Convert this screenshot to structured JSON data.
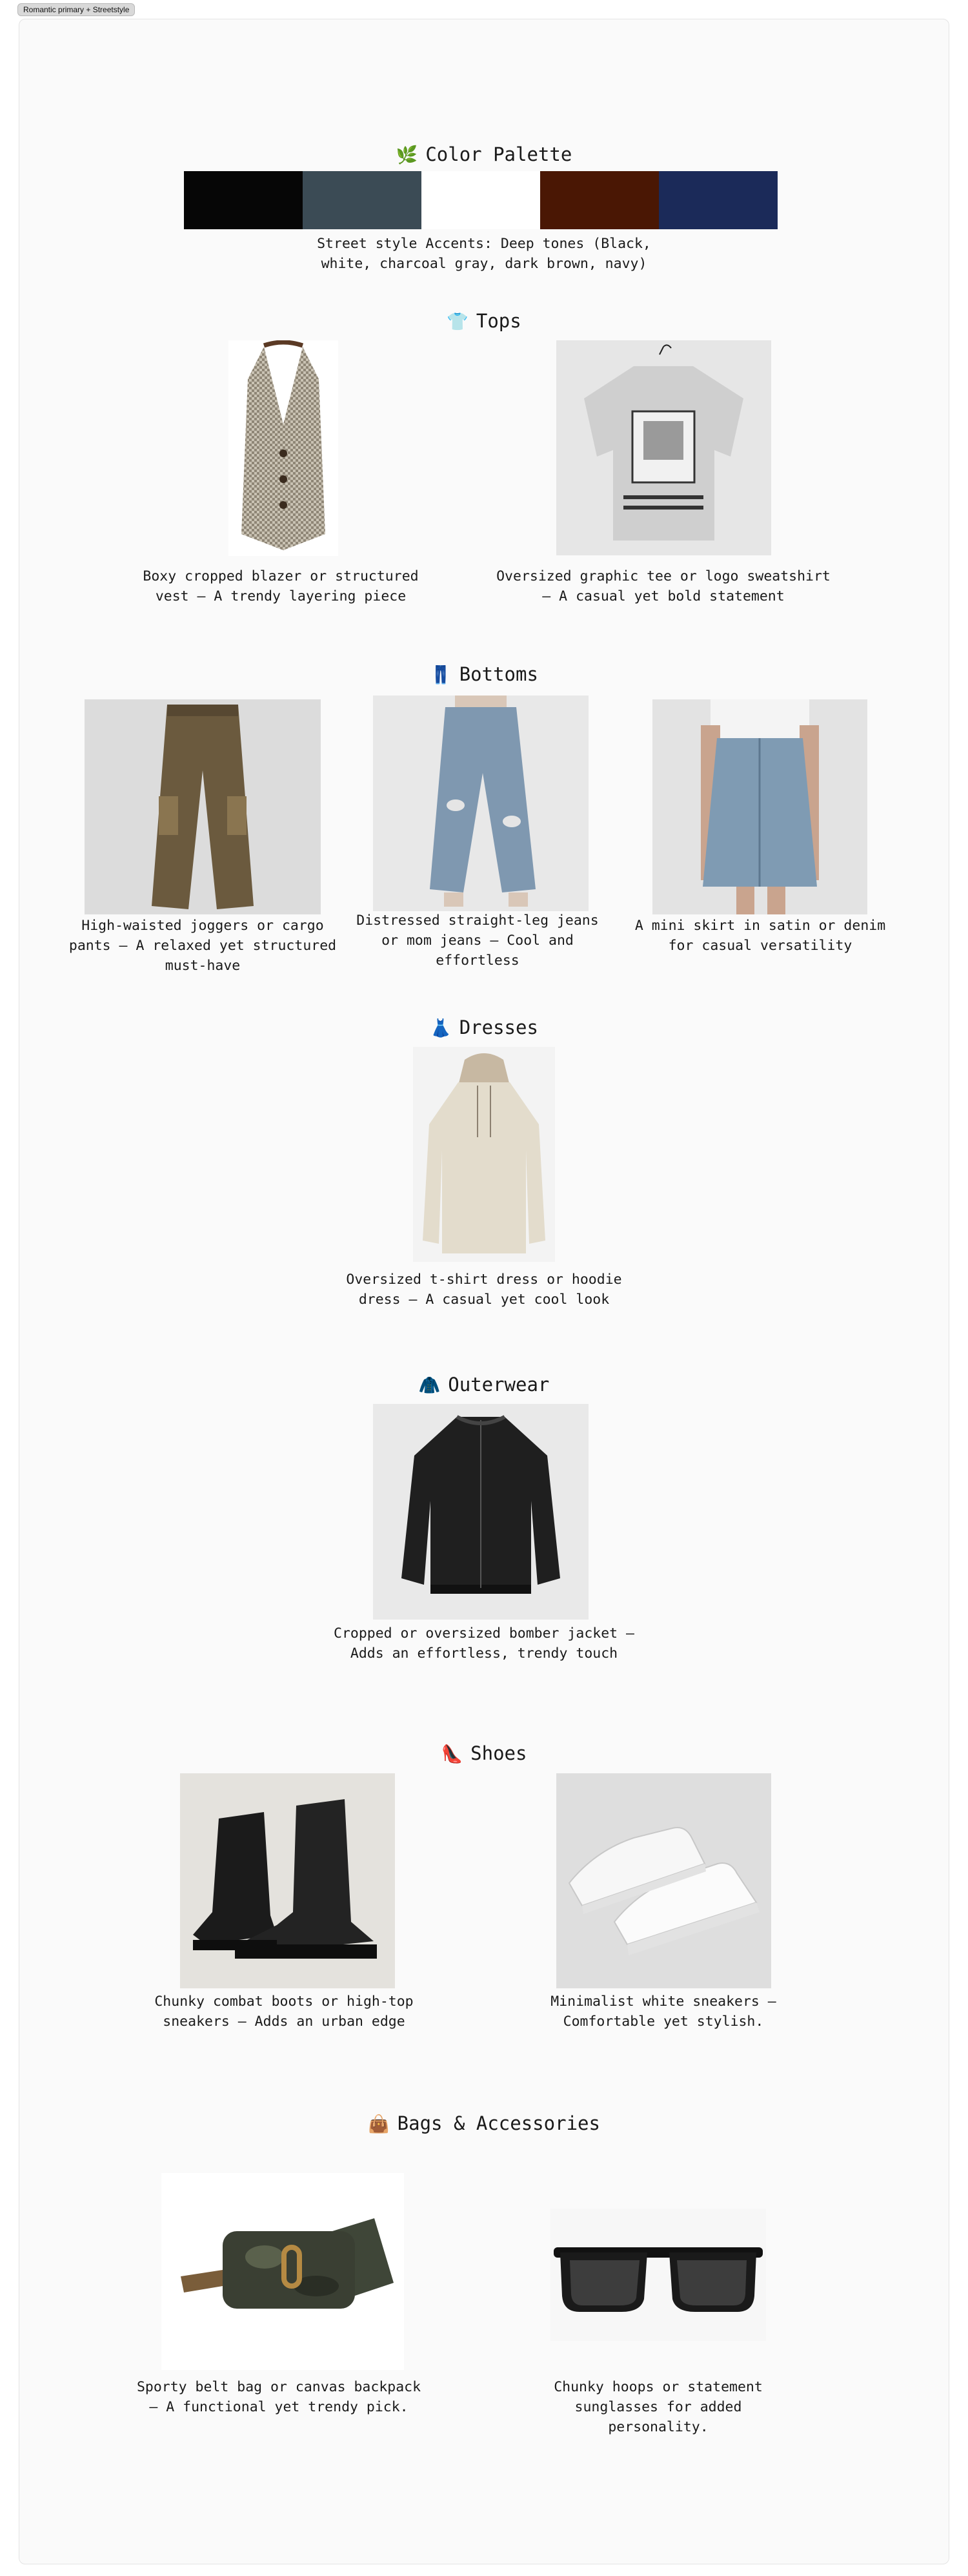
{
  "tab_label": "Romantic primary + Streetstyle",
  "palette": {
    "heading": "Color Palette",
    "heading_icon": "🌿",
    "swatches": [
      "#060606",
      "#3b4b55",
      "#ffffff",
      "#4a1704",
      "#1b2a59"
    ],
    "caption_line1": "Street style Accents: Deep tones (Black,",
    "caption_line2": "white, charcoal gray, dark brown, navy)"
  },
  "tops": {
    "heading": "Tops",
    "heading_icon": "👕",
    "items": [
      {
        "line1": "Boxy cropped blazer or structured",
        "line2": "vest – A trendy layering piece",
        "image": "houndstooth-vest"
      },
      {
        "line1": "Oversized graphic tee or logo sweatshirt",
        "line2": "– A casual yet bold statement",
        "image": "graphic-tee"
      }
    ]
  },
  "bottoms": {
    "heading": "Bottoms",
    "heading_icon": "👖",
    "items": [
      {
        "line1": "High-waisted joggers or cargo",
        "line2": "pants – A relaxed yet structured",
        "line3": "must-have",
        "image": "cargo-pants"
      },
      {
        "line1": "Distressed straight-leg jeans",
        "line2": "or mom jeans – Cool and",
        "line3": "effortless",
        "image": "distressed-jeans"
      },
      {
        "line1": "A mini skirt in satin or denim",
        "line2": "for casual versatility",
        "image": "denim-skirt"
      }
    ]
  },
  "dresses": {
    "heading": "Dresses",
    "heading_icon": "👗",
    "items": [
      {
        "line1": "Oversized t-shirt dress or hoodie",
        "line2": "dress – A casual yet cool look",
        "image": "hoodie-dress"
      }
    ]
  },
  "outerwear": {
    "heading": "Outerwear",
    "heading_icon": "🧥",
    "items": [
      {
        "line1": "Cropped or oversized bomber jacket –",
        "line2": "Adds an effortless, trendy touch",
        "image": "bomber-jacket"
      }
    ]
  },
  "shoes": {
    "heading": "Shoes",
    "heading_icon": "👠",
    "items": [
      {
        "line1": "Chunky combat boots or high-top",
        "line2": "sneakers – Adds an urban edge",
        "image": "combat-boots"
      },
      {
        "line1": "Minimalist white sneakers –",
        "line2": "Comfortable yet stylish.",
        "image": "white-sneakers"
      }
    ]
  },
  "bags": {
    "heading": "Bags & Accessories",
    "heading_icon": "👜",
    "items": [
      {
        "line1": "Sporty belt bag or canvas backpack",
        "line2": "– A functional yet trendy pick.",
        "image": "camo-belt-bag"
      },
      {
        "line1": "Chunky hoops or statement",
        "line2": "sunglasses for added",
        "line3": "personality.",
        "image": "black-sunglasses"
      }
    ]
  }
}
